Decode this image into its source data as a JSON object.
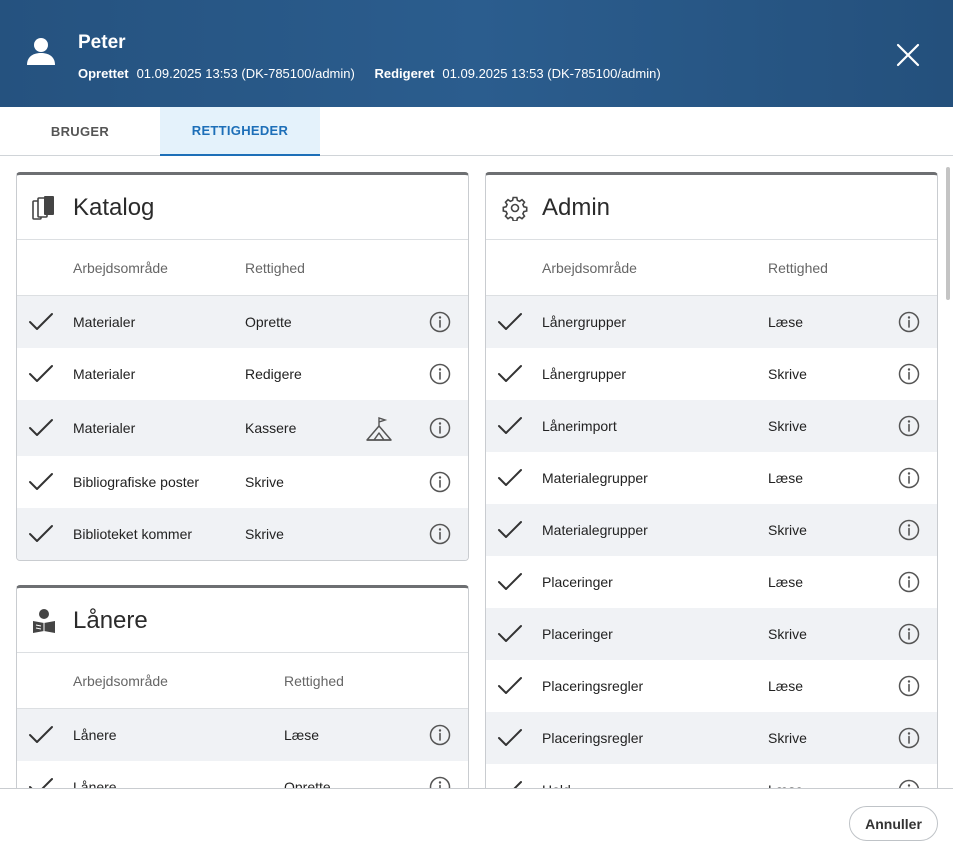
{
  "header": {
    "name": "Peter",
    "created_label": "Oprettet",
    "created_value": "01.09.2025 13:53 (DK-785100/admin)",
    "edited_label": "Redigeret",
    "edited_value": "01.09.2025 13:53 (DK-785100/admin)"
  },
  "tabs": [
    {
      "label": "BRUGER",
      "active": false
    },
    {
      "label": "RETTIGHEDER",
      "active": true
    }
  ],
  "katalog": {
    "title": "Katalog",
    "col_area": "Arbejdsområde",
    "col_right": "Rettighed",
    "rows": [
      {
        "area": "Materialer",
        "right": "Oprette"
      },
      {
        "area": "Materialer",
        "right": "Redigere"
      },
      {
        "area": "Materialer",
        "right": "Kassere"
      },
      {
        "area": "Bibliografiske poster",
        "right": "Skrive"
      },
      {
        "area": "Biblioteket kommer",
        "right": "Skrive"
      }
    ]
  },
  "laanere": {
    "title": "Lånere",
    "col_area": "Arbejdsområde",
    "col_right": "Rettighed",
    "rows": [
      {
        "area": "Lånere",
        "right": "Læse"
      },
      {
        "area": "Lånere",
        "right": "Oprette"
      }
    ]
  },
  "admin": {
    "title": "Admin",
    "col_area": "Arbejdsområde",
    "col_right": "Rettighed",
    "rows": [
      {
        "area": "Lånergrupper",
        "right": "Læse"
      },
      {
        "area": "Lånergrupper",
        "right": "Skrive"
      },
      {
        "area": "Lånerimport",
        "right": "Skrive"
      },
      {
        "area": "Materialegrupper",
        "right": "Læse"
      },
      {
        "area": "Materialegrupper",
        "right": "Skrive"
      },
      {
        "area": "Placeringer",
        "right": "Læse"
      },
      {
        "area": "Placeringer",
        "right": "Skrive"
      },
      {
        "area": "Placeringsregler",
        "right": "Læse"
      },
      {
        "area": "Placeringsregler",
        "right": "Skrive"
      },
      {
        "area": "Hold",
        "right": "Læse"
      }
    ]
  },
  "footer": {
    "cancel_label": "Annuller"
  },
  "icons": {
    "user": "user-icon",
    "close": "close-icon",
    "katalog": "books-icon",
    "laanere": "reader-icon",
    "admin": "gear-icon",
    "check": "check-icon",
    "info": "info-icon",
    "kassere_extra": "tent-icon"
  },
  "colors": {
    "header": "#2b5d8e",
    "accent": "#1d6fb8",
    "row_shade": "#f0f2f5"
  }
}
